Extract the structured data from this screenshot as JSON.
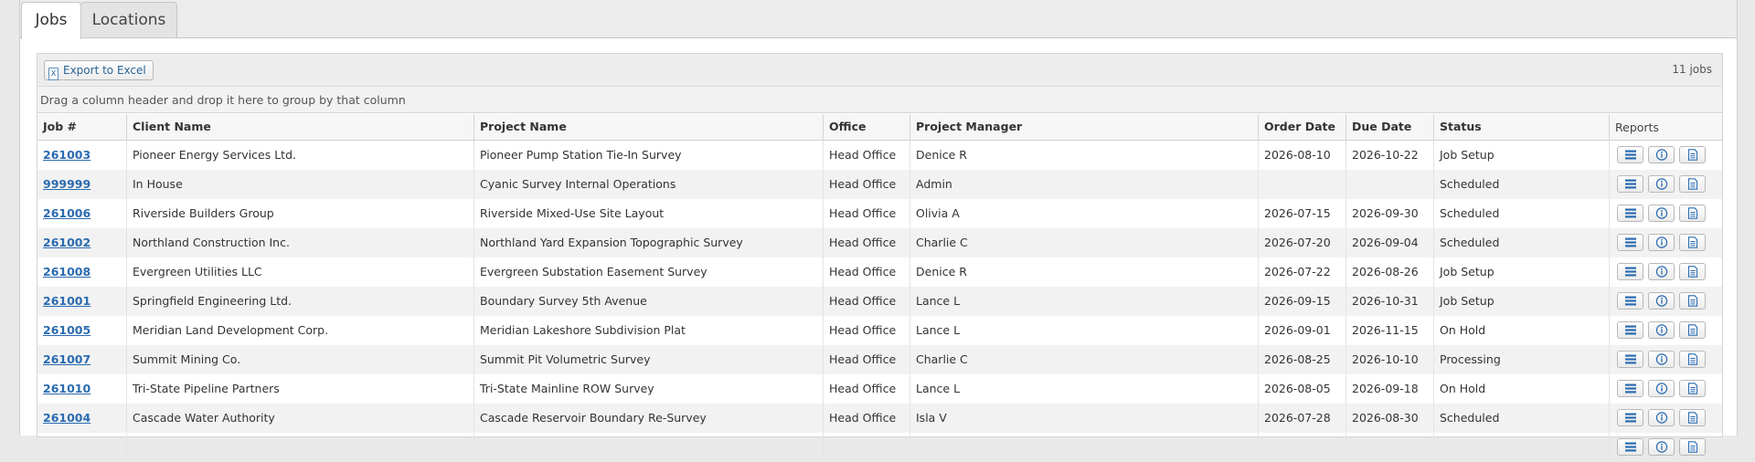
{
  "tabs": [
    {
      "label": "Jobs",
      "active": true
    },
    {
      "label": "Locations",
      "active": false
    }
  ],
  "toolbar": {
    "export_label": "Export to Excel",
    "count_label": "11 jobs"
  },
  "groupbar": {
    "hint": "Drag a column header and drop it here to group by that column"
  },
  "columns": [
    "Job #",
    "Client Name",
    "Project Name",
    "Office",
    "Project Manager",
    "Order Date",
    "Due Date",
    "Status",
    "Reports"
  ],
  "report_icons": [
    "list-icon",
    "info-icon",
    "document-icon"
  ],
  "accent_color": "#2a6bb0",
  "rows": [
    {
      "job": "261003",
      "client": "Pioneer Energy Services Ltd.",
      "project": "Pioneer Pump Station Tie-In Survey",
      "office": "Head Office",
      "manager": "Denice R",
      "order_date": "2026-08-10",
      "due_date": "2026-10-22",
      "status": "Job Setup"
    },
    {
      "job": "999999",
      "client": "In House",
      "project": "Cyanic Survey Internal Operations",
      "office": "Head Office",
      "manager": "Admin",
      "order_date": "",
      "due_date": "",
      "status": "Scheduled"
    },
    {
      "job": "261006",
      "client": "Riverside Builders Group",
      "project": "Riverside Mixed-Use Site Layout",
      "office": "Head Office",
      "manager": "Olivia A",
      "order_date": "2026-07-15",
      "due_date": "2026-09-30",
      "status": "Scheduled"
    },
    {
      "job": "261002",
      "client": "Northland Construction Inc.",
      "project": "Northland Yard Expansion Topographic Survey",
      "office": "Head Office",
      "manager": "Charlie C",
      "order_date": "2026-07-20",
      "due_date": "2026-09-04",
      "status": "Scheduled"
    },
    {
      "job": "261008",
      "client": "Evergreen Utilities LLC",
      "project": "Evergreen Substation Easement Survey",
      "office": "Head Office",
      "manager": "Denice R",
      "order_date": "2026-07-22",
      "due_date": "2026-08-26",
      "status": "Job Setup"
    },
    {
      "job": "261001",
      "client": "Springfield Engineering Ltd.",
      "project": "Boundary Survey 5th Avenue",
      "office": "Head Office",
      "manager": "Lance L",
      "order_date": "2026-09-15",
      "due_date": "2026-10-31",
      "status": "Job Setup"
    },
    {
      "job": "261005",
      "client": "Meridian Land Development Corp.",
      "project": "Meridian Lakeshore Subdivision Plat",
      "office": "Head Office",
      "manager": "Lance L",
      "order_date": "2026-09-01",
      "due_date": "2026-11-15",
      "status": "On Hold"
    },
    {
      "job": "261007",
      "client": "Summit Mining Co.",
      "project": "Summit Pit Volumetric Survey",
      "office": "Head Office",
      "manager": "Charlie C",
      "order_date": "2026-08-25",
      "due_date": "2026-10-10",
      "status": "Processing"
    },
    {
      "job": "261010",
      "client": "Tri-State Pipeline Partners",
      "project": "Tri-State Mainline ROW Survey",
      "office": "Head Office",
      "manager": "Lance L",
      "order_date": "2026-08-05",
      "due_date": "2026-09-18",
      "status": "On Hold"
    },
    {
      "job": "261004",
      "client": "Cascade Water Authority",
      "project": "Cascade Reservoir Boundary Re-Survey",
      "office": "Head Office",
      "manager": "Isla V",
      "order_date": "2026-07-28",
      "due_date": "2026-08-30",
      "status": "Scheduled"
    },
    {
      "job": "",
      "client": "",
      "project": "",
      "office": "",
      "manager": "",
      "order_date": "",
      "due_date": "",
      "status": ""
    }
  ]
}
